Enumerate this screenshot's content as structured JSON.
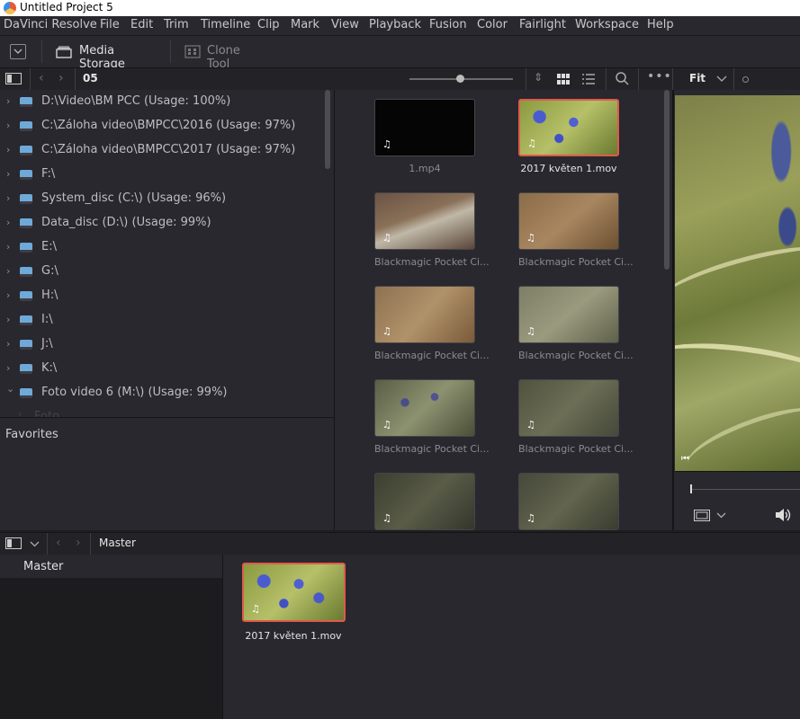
{
  "window": {
    "title": "Untitled Project 5"
  },
  "menu": [
    "DaVinci Resolve",
    "File",
    "Edit",
    "Trim",
    "Timeline",
    "Clip",
    "Mark",
    "View",
    "Playback",
    "Fusion",
    "Color",
    "Fairlight",
    "Workspace",
    "Help"
  ],
  "toolbar": {
    "media_storage": "Media Storage",
    "clone_tool": "Clone Tool"
  },
  "path": {
    "current_folder": "05",
    "viewer_zoom": "Fit"
  },
  "tree": [
    "D:\\Video\\BM PCC (Usage: 100%)",
    "C:\\Záloha video\\BMPCC\\2016 (Usage: 97%)",
    "C:\\Záloha video\\BMPCC\\2017 (Usage: 97%)",
    "F:\\",
    "System_disc (C:\\) (Usage: 96%)",
    "Data_disc (D:\\) (Usage: 99%)",
    "E:\\",
    "G:\\",
    "H:\\",
    "I:\\",
    "J:\\",
    "K:\\",
    "Foto video 6 (M:\\) (Usage: 99%)",
    "Foto"
  ],
  "favorites": "Favorites",
  "clips": [
    {
      "name": "1.mp4"
    },
    {
      "name": "2017 květen 1.mov"
    },
    {
      "name": "Blackmagic Pocket Ci..."
    },
    {
      "name": "Blackmagic Pocket Ci..."
    },
    {
      "name": "Blackmagic Pocket Ci..."
    },
    {
      "name": "Blackmagic Pocket Ci..."
    },
    {
      "name": "Blackmagic Pocket Ci..."
    },
    {
      "name": "Blackmagic Pocket Ci..."
    },
    {
      "name": ""
    },
    {
      "name": ""
    }
  ],
  "media_pool": {
    "breadcrumb": "Master",
    "bin": "Master",
    "clip": "2017 květen 1.mov"
  },
  "icons": {
    "music": "♫"
  }
}
